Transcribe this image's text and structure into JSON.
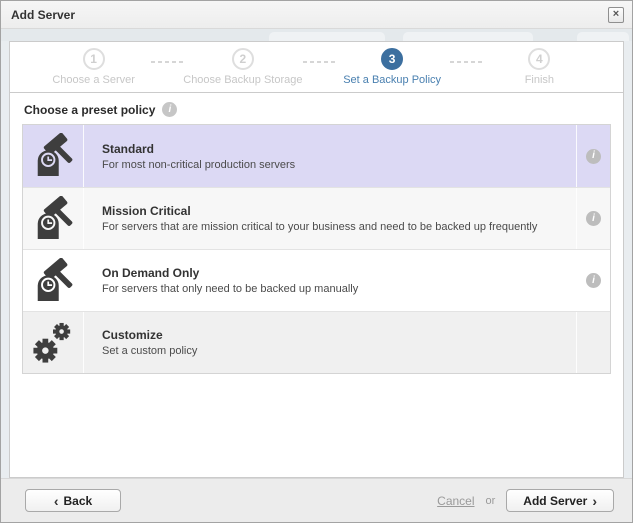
{
  "dialog": {
    "title": "Add Server",
    "close_glyph": "×"
  },
  "wizard": {
    "steps": [
      {
        "number": "1",
        "label": "Choose a Server",
        "active": false
      },
      {
        "number": "2",
        "label": "Choose Backup Storage",
        "active": false
      },
      {
        "number": "3",
        "label": "Set a Backup Policy",
        "active": true
      },
      {
        "number": "4",
        "label": "Finish",
        "active": false
      }
    ]
  },
  "content": {
    "heading": "Choose a preset policy",
    "heading_info_glyph": "i",
    "policies": [
      {
        "title": "Standard",
        "description": "For most non-critical production servers",
        "icon": "backup-schedule-icon",
        "selected": true,
        "info_glyph": "i"
      },
      {
        "title": "Mission Critical",
        "description": "For servers that are mission critical to your business and need to be backed up frequently",
        "icon": "backup-schedule-icon",
        "selected": false,
        "info_glyph": "i"
      },
      {
        "title": "On Demand Only",
        "description": "For servers that only need to be backed up manually",
        "icon": "backup-schedule-icon",
        "selected": false,
        "info_glyph": "i"
      },
      {
        "title": "Customize",
        "description": "Set a custom policy",
        "icon": "gears-icon",
        "selected": false,
        "info_glyph": ""
      }
    ]
  },
  "footer": {
    "back_label": "Back",
    "back_chevron": "‹",
    "cancel_label": "Cancel",
    "or_label": "or",
    "add_server_label": "Add Server",
    "add_server_chevron": "›"
  },
  "colors": {
    "accent_blue": "#3c6f9f",
    "active_label_blue": "#4a80b0",
    "selected_row": "#dcd9f4",
    "icon_dark": "#3e3e3e"
  }
}
